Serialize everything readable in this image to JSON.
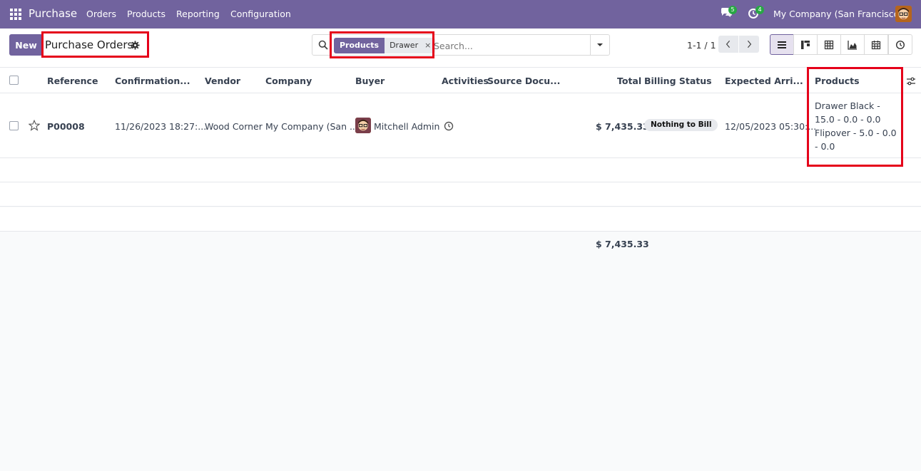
{
  "navbar": {
    "app_name": "Purchase",
    "menu": [
      "Orders",
      "Products",
      "Reporting",
      "Configuration"
    ],
    "messages_count": "5",
    "activities_count": "4",
    "company": "My Company (San Francisco)",
    "color": "#71639e"
  },
  "control_panel": {
    "new_label": "New",
    "title": "Purchase Orders",
    "search": {
      "facet_label": "Products",
      "facet_value": "Drawer",
      "facet_remove": "×",
      "placeholder": "Search..."
    },
    "pager": "1-1 / 1",
    "views": [
      "list",
      "kanban",
      "pivot",
      "graph",
      "calendar",
      "activity"
    ]
  },
  "table": {
    "columns": [
      "Reference",
      "Confirmation...",
      "Vendor",
      "Company",
      "Buyer",
      "Activities",
      "Source Docu...",
      "Total",
      "Billing Status",
      "Expected Arri...",
      "Products"
    ],
    "rows": [
      {
        "reference": "P00008",
        "confirmation": "11/26/2023 18:27:...",
        "vendor": "Wood Corner",
        "company": "My Company (San ...",
        "buyer": "Mitchell Admin",
        "source": "",
        "total": "$ 7,435.33",
        "billing_status": "Nothing to Bill",
        "expected_arrival": "12/05/2023 05:30:...",
        "products": [
          "Drawer Black - 15.0 - 0.0 - 0.0",
          "Flipover - 5.0 - 0.0 - 0.0"
        ]
      }
    ],
    "footer_total": "$ 7,435.33"
  },
  "highlight_color": "#e5001a"
}
